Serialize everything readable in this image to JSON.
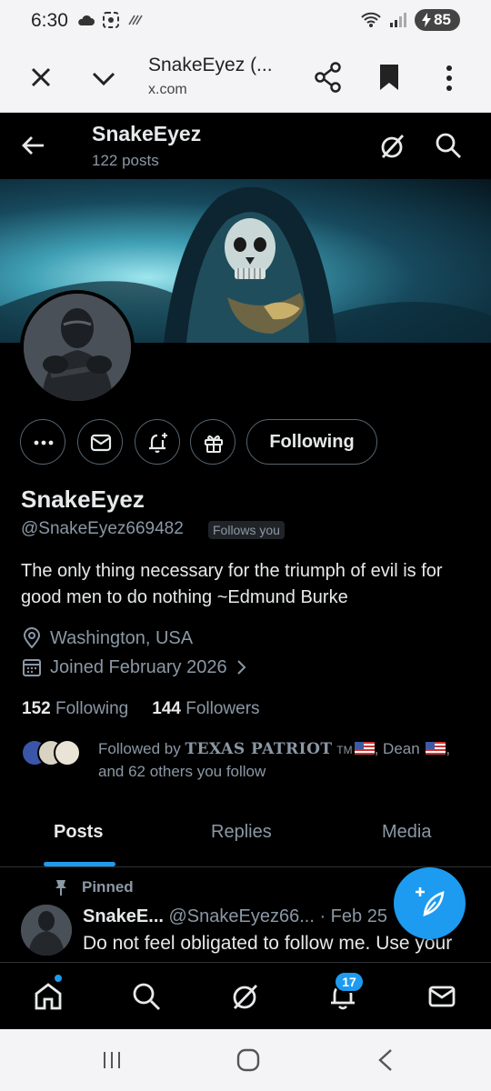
{
  "status_bar": {
    "time": "6:30",
    "battery": "85"
  },
  "browser": {
    "title": "SnakeEyez (...",
    "url": "x.com"
  },
  "header": {
    "name": "SnakeEyez",
    "posts_count": "122 posts"
  },
  "profile": {
    "following_button": "Following",
    "display_name": "SnakeEyez",
    "handle": "@SnakeEyez669482",
    "follows_you": "Follows you",
    "bio": "The only thing necessary for the triumph of evil is for good men to do nothing ~Edmund  Burke",
    "location": "Washington, USA",
    "joined": "Joined February 2026",
    "following_count": "152",
    "following_label": "Following",
    "followers_count": "144",
    "followers_label": "Followers",
    "followed_by_prefix": "Followed by",
    "followed_by_name1": "TEXAS PATRIOT",
    "followed_by_tm": "TM",
    "followed_by_name2": "Dean",
    "followed_by_suffix": "and 62 others you follow"
  },
  "tabs": [
    {
      "label": "Posts"
    },
    {
      "label": "Replies"
    },
    {
      "label": "Media"
    }
  ],
  "pinned_post": {
    "pinned_label": "Pinned",
    "author": "SnakeE...",
    "handle": "@SnakeEyez66...",
    "date": "· Feb 25",
    "text": "Do not feel obligated to follow me. Use your"
  },
  "bottom_nav": {
    "notifications_badge": "17"
  },
  "colors": {
    "accent": "#1d9bf0",
    "background": "#000000",
    "muted_text": "#8b98a5"
  }
}
